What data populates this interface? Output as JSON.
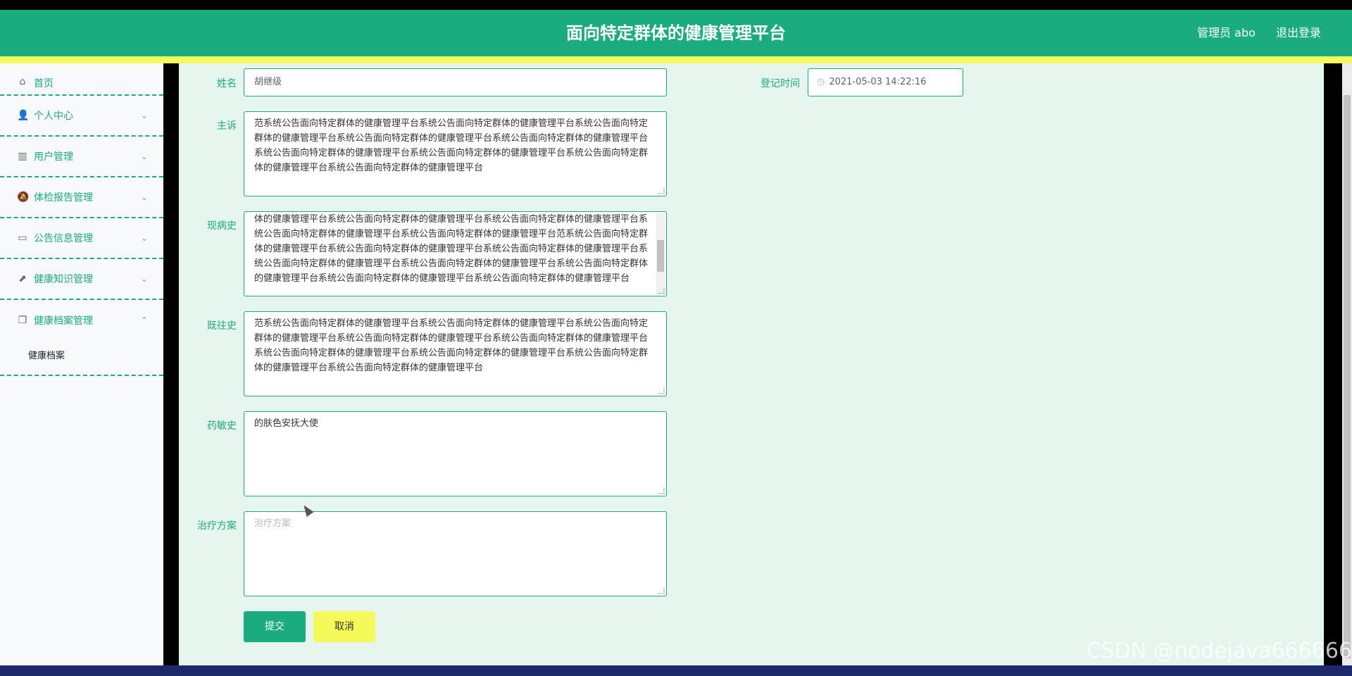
{
  "header": {
    "title": "面向特定群体的健康管理平台",
    "admin": "管理员 abo",
    "logout": "退出登录"
  },
  "sidebar": {
    "items": [
      {
        "label": "首页",
        "icon": "home-icon",
        "glyph": "⌂"
      },
      {
        "label": "个人中心",
        "icon": "user-icon",
        "glyph": "👤"
      },
      {
        "label": "用户管理",
        "icon": "books-icon",
        "glyph": "▥"
      },
      {
        "label": "体检报告管理",
        "icon": "bell-off-icon",
        "glyph": "🔕"
      },
      {
        "label": "公告信息管理",
        "icon": "chat-icon",
        "glyph": "▭"
      },
      {
        "label": "健康知识管理",
        "icon": "chart-icon",
        "glyph": "⬈"
      },
      {
        "label": "健康档案管理",
        "icon": "copy-icon",
        "glyph": "❐"
      }
    ],
    "sub_item": "健康档案"
  },
  "form": {
    "name_label": "姓名",
    "name_value": "胡继级",
    "time_label": "登记时间",
    "time_value": "2021-05-03 14:22:16",
    "complaint_label": "主诉",
    "complaint_value": "范系统公告面向特定群体的健康管理平台系统公告面向特定群体的健康管理平台系统公告面向特定群体的健康管理平台系统公告面向特定群体的健康管理平台系统公告面向特定群体的健康管理平台系统公告面向特定群体的健康管理平台系统公告面向特定群体的健康管理平台系统公告面向特定群体的健康管理平台系统公告面向特定群体的健康管理平台",
    "current_label": "现病史",
    "current_value": "体的健康管理平台系统公告面向特定群体的健康管理平台系统公告面向特定群体的健康管理平台系统公告面向特定群体的健康管理平台系统公告面向特定群体的健康管理平台范系统公告面向特定群体的健康管理平台系统公告面向特定群体的健康管理平台系统公告面向特定群体的健康管理平台系统公告面向特定群体的健康管理平台系统公告面向特定群体的健康管理平台系统公告面向特定群体的健康管理平台系统公告面向特定群体的健康管理平台系统公告面向特定群体的健康管理平台",
    "past_label": "既往史",
    "past_value": "范系统公告面向特定群体的健康管理平台系统公告面向特定群体的健康管理平台系统公告面向特定群体的健康管理平台系统公告面向特定群体的健康管理平台系统公告面向特定群体的健康管理平台系统公告面向特定群体的健康管理平台系统公告面向特定群体的健康管理平台系统公告面向特定群体的健康管理平台系统公告面向特定群体的健康管理平台",
    "allergy_label": "药敏史",
    "allergy_value": "的肤色安抚大使",
    "plan_label": "治疗方案",
    "plan_placeholder": "治疗方案",
    "submit": "提交",
    "cancel": "取消"
  },
  "watermark": "CSDN @nodejava666666",
  "colors": {
    "primary": "#1aac7e",
    "accent": "#f6f95a",
    "panel": "#e7f5ef"
  }
}
